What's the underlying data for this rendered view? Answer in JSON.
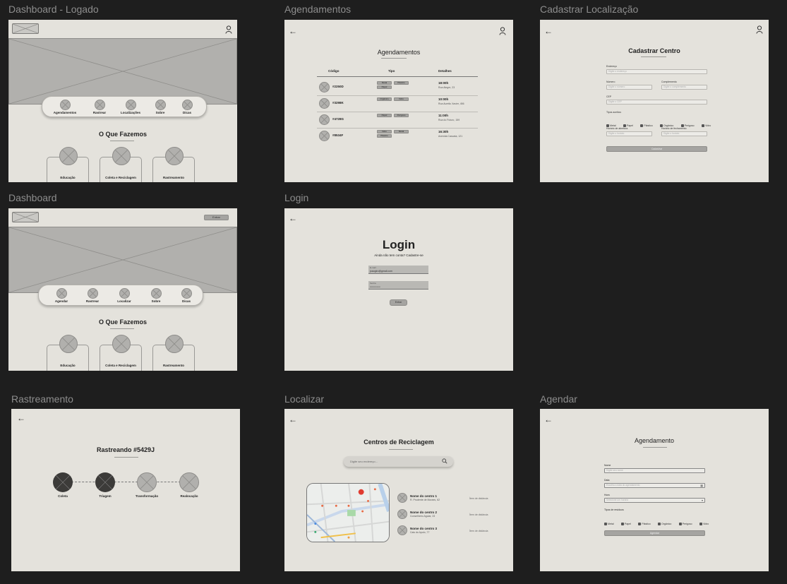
{
  "frames": {
    "dash_logado": {
      "label": "Dashboard - Logado",
      "nav": [
        "Agendamentos",
        "Rastrear",
        "Localizações",
        "Sobre",
        "Dicas"
      ],
      "section_title": "O Que Fazemos",
      "cards": [
        "Educação",
        "Coleta e Reciclagem",
        "Rastreamento"
      ]
    },
    "agendamentos": {
      "label": "Agendamentos",
      "title": "Agendamentos",
      "headers": [
        "Código",
        "Tipo",
        "Detalhes"
      ],
      "rows": [
        {
          "code": "#2250D",
          "tags": [
            "Metal",
            "Plástico",
            "Papel"
          ],
          "time": "18:00h",
          "addr": "Rua Alegre, 23"
        },
        {
          "code": "#3298K",
          "tags": [
            "Orgânico",
            "Vidro"
          ],
          "time": "10:00h",
          "addr": "Rua Aurelio Xavier, 456"
        },
        {
          "code": "#4728G",
          "tags": [
            "Papel",
            "Perigoso"
          ],
          "time": "11:00h",
          "addr": "Rua do Futuro, 159"
        },
        {
          "code": "#8534F",
          "tags": [
            "Vidro",
            "Metal",
            "Plástico"
          ],
          "time": "16:30h",
          "addr": "Avenida Cascata, 121"
        }
      ]
    },
    "cadastrar": {
      "label": "Cadastrar Localização",
      "title": "Cadastrar Centro",
      "endereco_label": "Endereço",
      "endereco_ph": "Digite o endereço",
      "numero_label": "Número",
      "numero_ph": "Digite o número",
      "complemento_label": "Complemento",
      "complemento_ph": "Digite o complemento",
      "cep_label": "CEP",
      "cep_ph": "Digite o CEP",
      "tipos_label": "Tipos aceitos:",
      "tipos": [
        "Metal",
        "Papel",
        "Plástico",
        "Orgânico",
        "Perigoso",
        "Vidro"
      ],
      "abertura_label": "Horário de abertura",
      "abertura_ph": "Digite o horário",
      "fechamento_label": "Horário de fechamento",
      "fechamento_ph": "Digite o horário",
      "submit": "Cadastrar"
    },
    "dash": {
      "label": "Dashboard",
      "enter": "Entrar",
      "nav": [
        "Agendar",
        "Rastrear",
        "Localizar",
        "Sobre",
        "Dicas"
      ],
      "section_title": "O Que Fazemos",
      "cards": [
        "Educação",
        "Coleta e Reciclagem",
        "Rastreamento"
      ]
    },
    "login": {
      "label": "Login",
      "title": "Login",
      "subtitle": "Ainda não tem conta? Cadastre-se",
      "email_label": "E-mail",
      "email_value": "joaogiro@gmail.com",
      "senha_label": "Senha",
      "senha_value": "••••••••••••••",
      "submit": "Entrar"
    },
    "rastreamento": {
      "label": "Rastreamento",
      "title": "Rastreando #5429J",
      "steps": [
        "Coleta",
        "Triagem",
        "Transformação",
        "Realocação"
      ]
    },
    "localizar": {
      "label": "Localizar",
      "title": "Centros de Reciclagem",
      "search_ph": "Digite seu endereço...",
      "centers": [
        {
          "name": "Nome do centro 1",
          "addr": "R. Prudente de Moraes, 62",
          "dist": "Ítem de distância"
        },
        {
          "name": "Nome do centro 2",
          "addr": "Conselheiro Aguiar, 23",
          "dist": "Ítem de distância"
        },
        {
          "name": "Nome do centro 3",
          "addr": "Cais do Apolo, 77",
          "dist": "Ítem de distância"
        }
      ]
    },
    "agendar": {
      "label": "Agendar",
      "title": "Agendamento",
      "nome_label": "Nome",
      "nome_ph": "Digite seu nome",
      "data_label": "Data",
      "data_ph": "Escolha a data do agendamento",
      "hora_label": "Hora",
      "hora_ph": "Selecione um horário",
      "tipos_label": "Tipos de resíduos",
      "tipos": [
        "Metal",
        "Papel",
        "Plástico",
        "Orgânico",
        "Perigoso",
        "Vidro"
      ],
      "submit": "Agendar"
    }
  }
}
